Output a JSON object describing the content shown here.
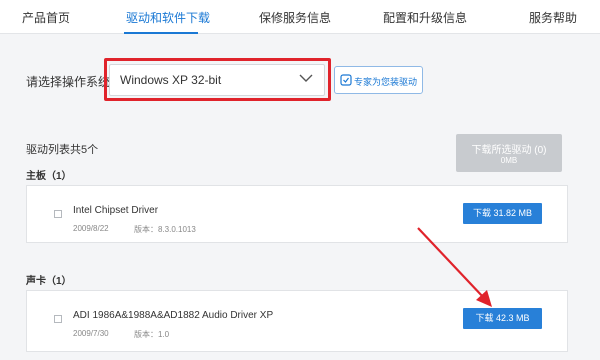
{
  "tabs": [
    {
      "label": "产品首页"
    },
    {
      "label": "驱动和软件下载"
    },
    {
      "label": "保修服务信息"
    },
    {
      "label": "配置和升级信息"
    },
    {
      "label": "服务帮助"
    }
  ],
  "os_selector": {
    "label": "请选择操作系统",
    "value": "Windows XP 32-bit"
  },
  "expert_button": {
    "label": "专家为您装驱动"
  },
  "driver_list": {
    "count_label": "驱动列表共5个",
    "download_selected": {
      "label": "下载所选驱动 (0)",
      "size": "0MB"
    }
  },
  "categories": [
    {
      "title": "主板（1）",
      "drivers": [
        {
          "name": "Intel Chipset Driver",
          "date": "2009/8/22",
          "version_label": "版本：8.3.0.1013",
          "button": "下载 31.82 MB"
        }
      ]
    },
    {
      "title": "声卡（1）",
      "drivers": [
        {
          "name": "ADI 1986A&1988A&AD1882 Audio Driver XP",
          "date": "2009/7/30",
          "version_label": "版本：1.0",
          "button": "下载 42.3 MB"
        }
      ]
    }
  ],
  "colors": {
    "accent": "#2880d8",
    "highlight": "#e0232b",
    "disabled": "#c8cbcf"
  }
}
